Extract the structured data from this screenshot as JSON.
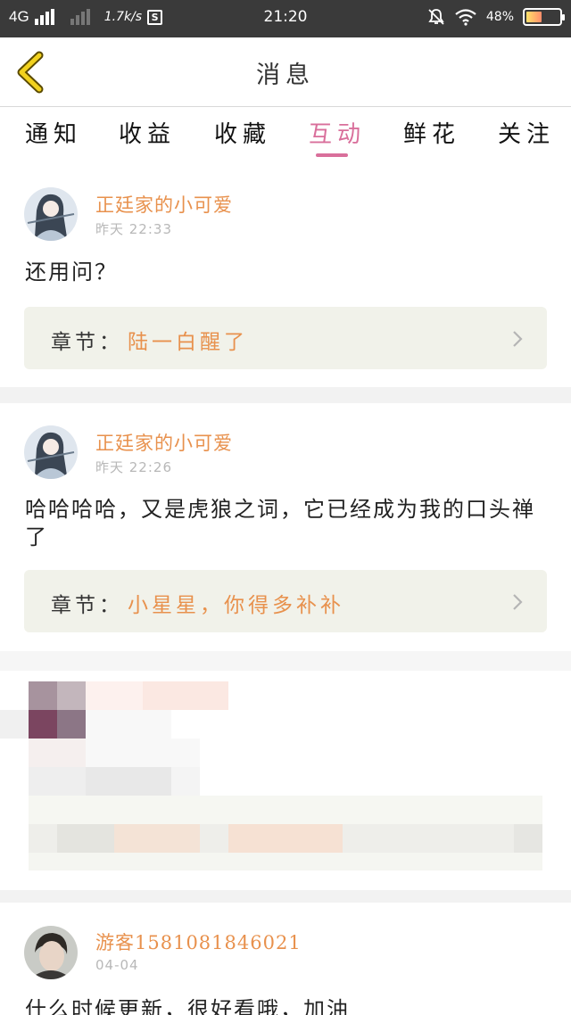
{
  "status_bar": {
    "network": "4G",
    "speed": "1.7k/s",
    "s_badge": "S",
    "time": "21:20",
    "battery": "48%",
    "battery_level": 0.48
  },
  "header": {
    "title": "消息"
  },
  "tabs": [
    "通知",
    "收益",
    "收藏",
    "互动",
    "鲜花",
    "关注"
  ],
  "active_tab": "互动",
  "messages": [
    {
      "user": "正廷家的小可爱",
      "time": "昨天 22:33",
      "content": "还用问？",
      "chapter_label": "章节：",
      "chapter_title": "陆一白醒了"
    },
    {
      "user": "正廷家的小可爱",
      "time": "昨天 22:26",
      "content": "哈哈哈哈，又是虎狼之词，它已经成为我的口头禅了",
      "chapter_label": "章节：",
      "chapter_title": "小星星，你得多补补"
    },
    {
      "user": "游客1581081846021",
      "time": "04-04",
      "content": "什么时候更新，很好看哦，加油"
    }
  ],
  "colors": {
    "accent": "#d96f9b",
    "username": "#e8914d",
    "status_bar": "#3a3a3a",
    "chapter_bg": "#f1f2ea"
  }
}
